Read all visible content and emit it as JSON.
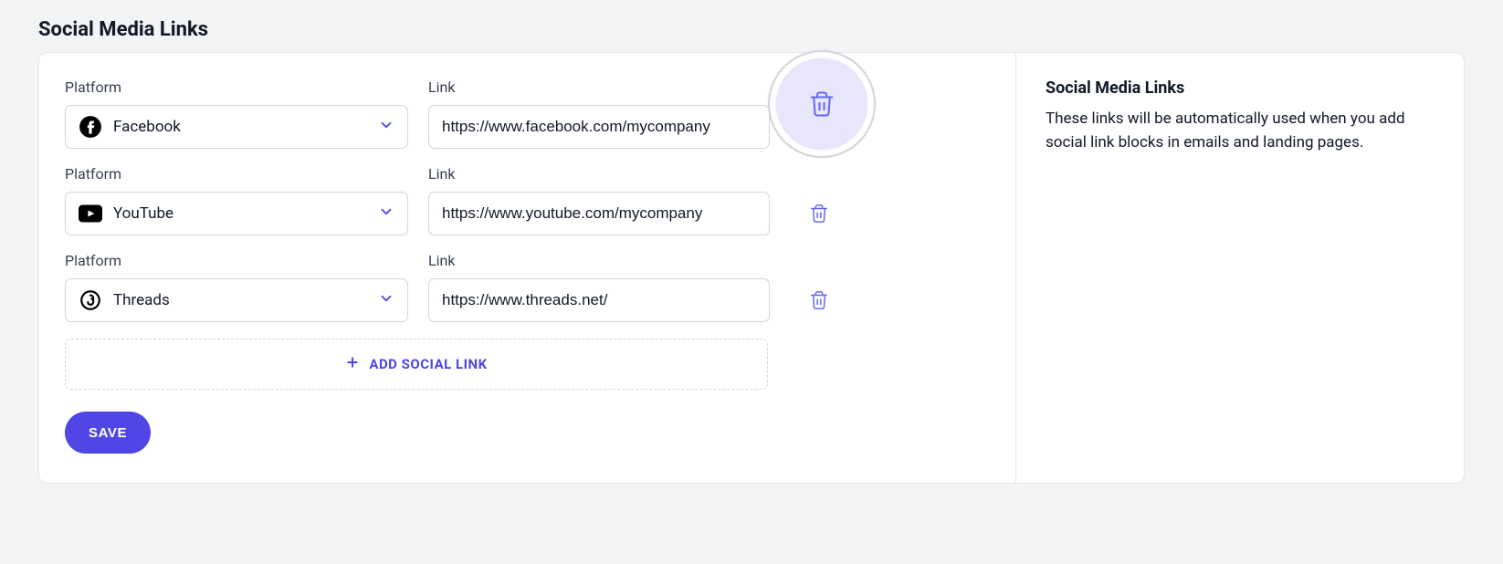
{
  "section_title": "Social Media Links",
  "labels": {
    "platform": "Platform",
    "link": "Link"
  },
  "rows": [
    {
      "platform": "Facebook",
      "icon": "facebook",
      "link": "https://www.facebook.com/mycompany",
      "delete_highlighted": true
    },
    {
      "platform": "YouTube",
      "icon": "youtube",
      "link": "https://www.youtube.com/mycompany",
      "delete_highlighted": false
    },
    {
      "platform": "Threads",
      "icon": "threads",
      "link": "https://www.threads.net/",
      "delete_highlighted": false
    }
  ],
  "add_button_label": "ADD SOCIAL LINK",
  "save_button_label": "SAVE",
  "side": {
    "title": "Social Media Links",
    "description": "These links will be automatically used when you add social link blocks in emails and landing pages."
  },
  "colors": {
    "accent": "#4f46e5",
    "border": "#d1d5db",
    "icon": "#6366f1"
  }
}
